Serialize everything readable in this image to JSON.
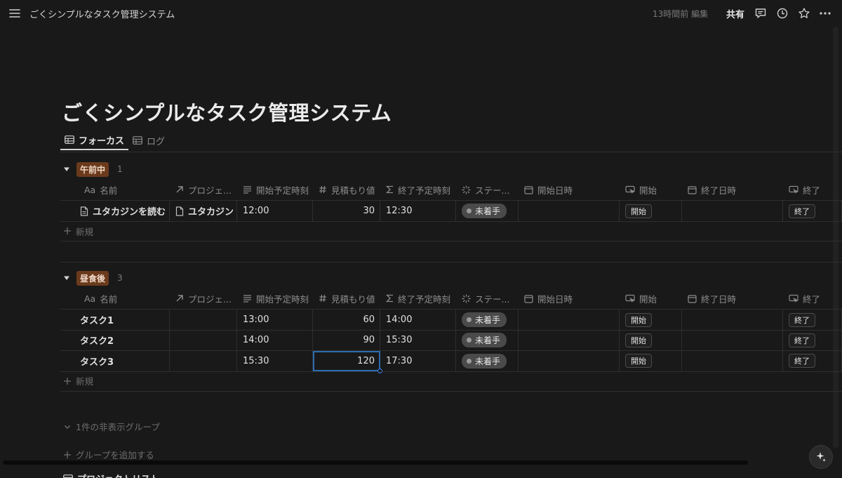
{
  "topbar": {
    "breadcrumb": "ごくシンプルなタスク管理システム",
    "edited": "13時間前 編集",
    "share": "共有"
  },
  "page": {
    "title": "ごくシンプルなタスク管理システム"
  },
  "tabs": [
    {
      "label": "フォーカス",
      "active": true
    },
    {
      "label": "ログ",
      "active": false
    }
  ],
  "columns": [
    {
      "label": "名前",
      "icon": "aa-icon"
    },
    {
      "label": "プロジェ...",
      "icon": "relation-arrow-icon"
    },
    {
      "label": "開始予定時刻",
      "icon": "text-lines-icon"
    },
    {
      "label": "見積もり値",
      "icon": "hash-icon"
    },
    {
      "label": "終了予定時刻",
      "icon": "sigma-icon"
    },
    {
      "label": "ステー...",
      "icon": "status-icon"
    },
    {
      "label": "開始日時",
      "icon": "calendar-icon"
    },
    {
      "label": "開始",
      "icon": "button-cursor-icon"
    },
    {
      "label": "終了日時",
      "icon": "calendar-icon"
    },
    {
      "label": "終了",
      "icon": "button-cursor-icon"
    }
  ],
  "header_aa": "Aa",
  "groups": [
    {
      "tag": "午前中",
      "count": "1",
      "rows": [
        {
          "name": "ユタカジンを読む",
          "has_page_icon": true,
          "project": "ユタカジン",
          "start": "12:00",
          "estimate": "30",
          "end": "12:30",
          "status": "未着手",
          "start_btn": "開始",
          "end_btn": "終了"
        }
      ]
    },
    {
      "tag": "昼食後",
      "count": "3",
      "rows": [
        {
          "name": "タスク1",
          "has_page_icon": false,
          "project": "",
          "start": "13:00",
          "estimate": "60",
          "end": "14:00",
          "status": "未着手",
          "start_btn": "開始",
          "end_btn": "終了"
        },
        {
          "name": "タスク2",
          "has_page_icon": false,
          "project": "",
          "start": "14:00",
          "estimate": "90",
          "end": "15:30",
          "status": "未着手",
          "start_btn": "開始",
          "end_btn": "終了"
        },
        {
          "name": "タスク3",
          "has_page_icon": false,
          "project": "",
          "start": "15:30",
          "estimate": "120",
          "end": "17:30",
          "status": "未着手",
          "start_btn": "開始",
          "end_btn": "終了"
        }
      ]
    }
  ],
  "new_row_label": "新規",
  "hidden_groups_label": "1件の非表示グループ",
  "add_group_label": "グループを追加する",
  "next_section_label": "プロジェクトリスト",
  "colors": {
    "background": "#191919",
    "group_tag": "#6b3a1c",
    "selection": "#2b6cb0",
    "status_pill": "#4a4a4a"
  }
}
